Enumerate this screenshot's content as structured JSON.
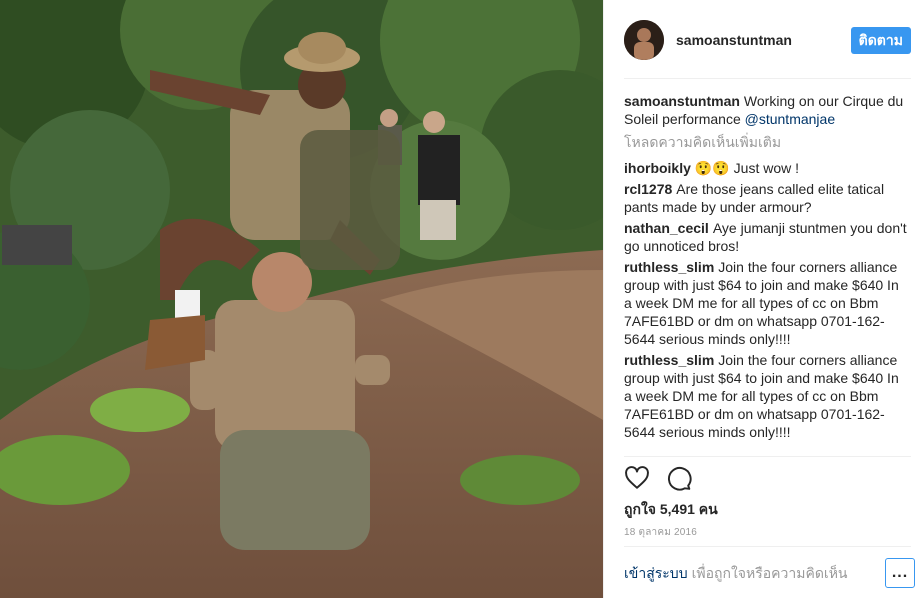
{
  "post": {
    "image_alt": "Two actors posing on a jungle film set"
  },
  "header": {
    "username": "samoanstuntman",
    "follow_label": "ติดตาม"
  },
  "caption": {
    "username": "samoanstuntman",
    "text": "Working on our Cirque du Soleil performance",
    "mention": "@stuntmanjae"
  },
  "load_more_label": "โหลดความคิดเห็นเพิ่มเติม",
  "comments": [
    {
      "username": "ihorboikly",
      "text": "😲😲 Just wow !"
    },
    {
      "username": "rcl1278",
      "text": "Are those jeans called elite tatical pants made by under armour?"
    },
    {
      "username": "nathan_cecil",
      "text": "Aye jumanji stuntmen you don't go unnoticed bros!"
    },
    {
      "username": "ruthless_slim",
      "text": "Join the four corners alliance group with just $64 to join and make $640 In a week DM me for all types of cc on Bbm 7AFE61BD or dm on whatsapp 0701-162-5644 serious minds only!!!!"
    },
    {
      "username": "ruthless_slim",
      "text": "Join the four corners alliance group with just $64 to join and make $640 In a week DM me for all types of cc on Bbm 7AFE61BD or dm on whatsapp 0701-162-5644 serious minds only!!!!"
    }
  ],
  "actions": {
    "like_icon": "heart-icon",
    "comment_icon": "comment-icon"
  },
  "likes_label": "ถูกใจ 5,491 คน",
  "date_label": "18 ตุลาคม 2016",
  "footer": {
    "login_label": "เข้าสู่ระบบ",
    "rest_label": "เพื่อถูกใจหรือความคิดเห็น",
    "more_label": "..."
  },
  "colors": {
    "accent": "#3897f0",
    "link": "#003569",
    "muted": "#999999"
  }
}
